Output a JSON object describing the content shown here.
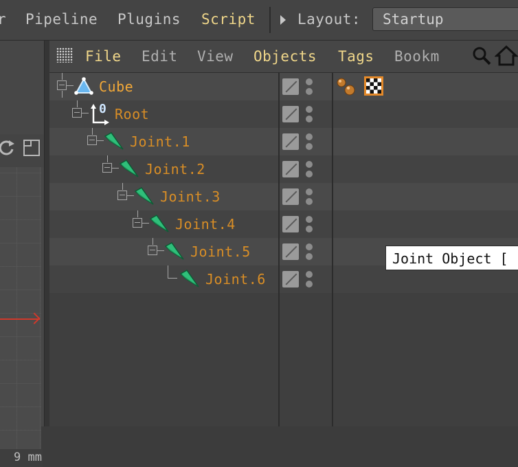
{
  "main_menu": {
    "partial_left": "r",
    "items": [
      "Pipeline",
      "Plugins",
      "Script"
    ],
    "layout_label": "Layout:",
    "layout_value": "Startup"
  },
  "viewport": {
    "unit_label": "9 mm"
  },
  "object_manager": {
    "menu": [
      "File",
      "Edit",
      "View",
      "Objects",
      "Tags",
      "Bookm"
    ],
    "objects": [
      {
        "name": "Cube",
        "type": "cube",
        "depth": 0
      },
      {
        "name": "Root",
        "type": "null",
        "depth": 1
      },
      {
        "name": "Joint.1",
        "type": "joint",
        "depth": 2
      },
      {
        "name": "Joint.2",
        "type": "joint",
        "depth": 3
      },
      {
        "name": "Joint.3",
        "type": "joint",
        "depth": 4
      },
      {
        "name": "Joint.4",
        "type": "joint",
        "depth": 5
      },
      {
        "name": "Joint.5",
        "type": "joint",
        "depth": 6
      },
      {
        "name": "Joint.6",
        "type": "joint",
        "depth": 7
      }
    ],
    "root_icon_text": "0",
    "tooltip": "Joint Object ["
  },
  "colors": {
    "menu_highlight": "#f0d78a",
    "object_label": "#d98e26",
    "joint_icon": "#2fbf7a",
    "cube_icon": "#69b7f0"
  }
}
